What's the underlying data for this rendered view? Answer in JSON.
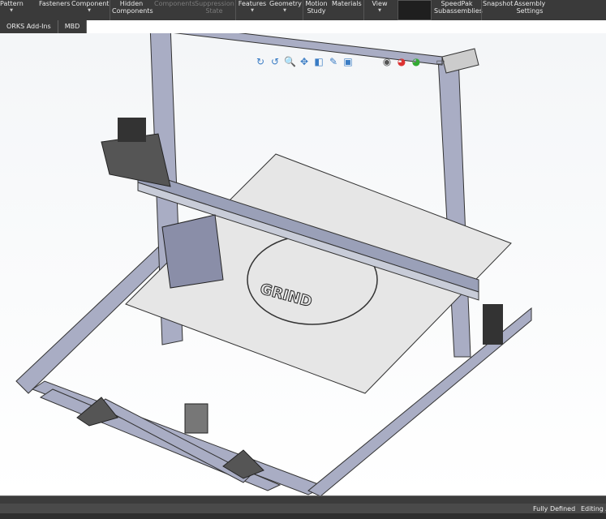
{
  "ribbon": {
    "items": [
      {
        "label": "Pattern",
        "dropdown": true,
        "enabled": true
      },
      {
        "label": "Fasteners",
        "enabled": true
      },
      {
        "label": "Component",
        "dropdown": true,
        "enabled": true
      },
      {
        "label": "Hidden Components",
        "enabled": true
      },
      {
        "label": "Components",
        "enabled": false
      },
      {
        "label": "Suppression State",
        "enabled": false
      },
      {
        "label": "Features",
        "dropdown": true,
        "enabled": true
      },
      {
        "label": "Geometry",
        "dropdown": true,
        "enabled": true
      },
      {
        "label": "Motion Study",
        "enabled": true
      },
      {
        "label": "Materials",
        "enabled": true
      },
      {
        "label": "View",
        "dropdown": true,
        "enabled": true
      },
      {
        "label": "SpeedPak Subassemblies",
        "enabled": true
      },
      {
        "label": "Snapshot",
        "enabled": true
      },
      {
        "label": "Assembly Settings",
        "enabled": true
      }
    ]
  },
  "tabs": [
    "ORKS Add-Ins",
    "MBD"
  ],
  "heads_up_toolbar": [
    "rotate-icon",
    "redo-icon",
    "zoom-icon",
    "pan-icon",
    "section-icon",
    "appearance-icon",
    "display-style-icon",
    "hide-show-icon",
    "edit-appearance-icon",
    "scene-icon",
    "display-icon"
  ],
  "status": {
    "defined": "Fully Defined",
    "editing": "Editing A"
  },
  "colors": {
    "ribbon": "#3a3a3a",
    "frame": "#9aa0b8",
    "plate": "#e6e6e6"
  }
}
